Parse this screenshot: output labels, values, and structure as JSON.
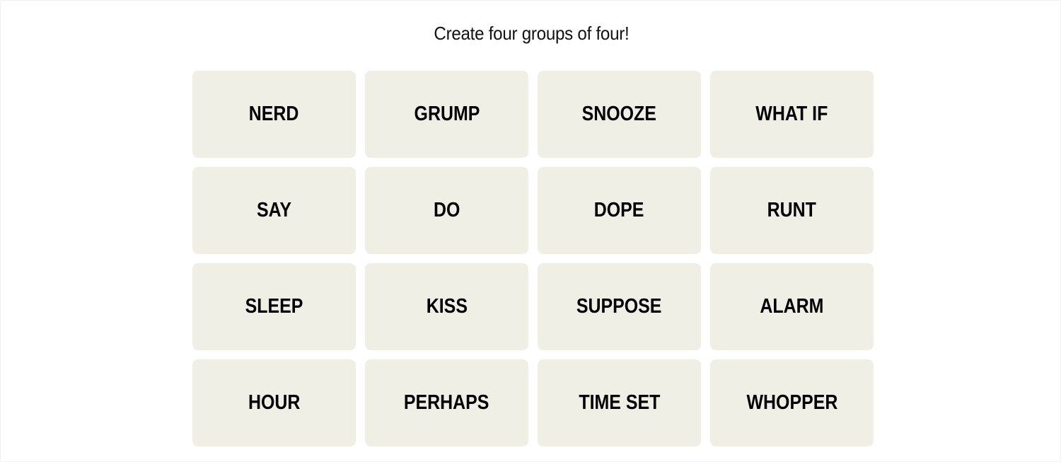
{
  "heading": "Create four groups of four!",
  "colors": {
    "tile_background": "#efefe6",
    "tile_text": "#000000",
    "page_background": "#ffffff"
  },
  "tiles": [
    {
      "label": "NERD",
      "selected": false
    },
    {
      "label": "GRUMP",
      "selected": false
    },
    {
      "label": "SNOOZE",
      "selected": false
    },
    {
      "label": "WHAT IF",
      "selected": false
    },
    {
      "label": "SAY",
      "selected": false
    },
    {
      "label": "DO",
      "selected": false
    },
    {
      "label": "DOPE",
      "selected": false
    },
    {
      "label": "RUNT",
      "selected": false
    },
    {
      "label": "SLEEP",
      "selected": false
    },
    {
      "label": "KISS",
      "selected": false
    },
    {
      "label": "SUPPOSE",
      "selected": false
    },
    {
      "label": "ALARM",
      "selected": false
    },
    {
      "label": "HOUR",
      "selected": false
    },
    {
      "label": "PERHAPS",
      "selected": false
    },
    {
      "label": "TIME SET",
      "selected": false
    },
    {
      "label": "WHOPPER",
      "selected": false
    }
  ]
}
